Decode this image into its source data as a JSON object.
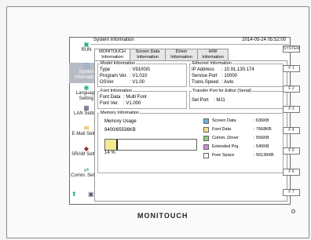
{
  "window": {
    "title": "System Information",
    "datetime": "2014-05-24  05:52:00"
  },
  "sidebar": {
    "items": [
      {
        "label": "RUN",
        "icon": "monitor-icon"
      },
      {
        "label": "System Information",
        "icon": "info-icon"
      },
      {
        "label": "Language Setting",
        "icon": "globe-icon"
      },
      {
        "label": "LAN Setting",
        "icon": "lan-icon"
      },
      {
        "label": "E-Mail Setting",
        "icon": "mail-icon"
      },
      {
        "label": "SRAM Setting",
        "icon": "sram-icon"
      },
      {
        "label": "Comm. Setting",
        "icon": "comm-icon"
      }
    ]
  },
  "tabs": [
    {
      "l1": "MONITOUCH",
      "l2": "Information"
    },
    {
      "l1": "Screen Data",
      "l2": "Information"
    },
    {
      "l1": "Driver",
      "l2": "Information"
    },
    {
      "l1": "H/W",
      "l2": "Information"
    }
  ],
  "model": {
    "title": "Model Information",
    "type_label": "Type",
    "type_value": ":  V9100iS",
    "program_label": "Program Ver.",
    "program_value": ":  V1.010",
    "os_label": "OSVer",
    "os_value": ":  V1.00"
  },
  "ethernet": {
    "title": "Ethernet Information",
    "ip_label": "IP Address",
    "ip_value": ":  10.91.130.174",
    "port_label": "Service Port",
    "port_value": ":  10000",
    "speed_label": "Trans.Speed",
    "speed_value": ":  Auto"
  },
  "font": {
    "title": "Font Information",
    "data_label": "Font Data",
    "data_value": ":  Multi Font",
    "ver_label": "Font Ver.",
    "ver_value": ":  V1.000"
  },
  "transfer": {
    "title": "Transfer Port for Editor (Serial)",
    "port_label": "Set Port",
    "port_value": ":  MJ1"
  },
  "memory": {
    "title": "Memory Information",
    "usage_label": "Memory Usage",
    "usage_value": "9400/65536KB",
    "percent_label": "14 %",
    "percent": 14,
    "legend": [
      {
        "name": "Screen Data",
        "value": ":    636KB",
        "color": "#6fb2d9"
      },
      {
        "name": "Font Data",
        "value": ":   7668KB",
        "color": "#f0e38a"
      },
      {
        "name": "Comm. Driver",
        "value": ":    556KB",
        "color": "#8fce7a"
      },
      {
        "name": "Extended Prg.",
        "value": ":    540KB",
        "color": "#c78fd2"
      },
      {
        "name": "Free Space",
        "value": ":  56136KB",
        "color": "#ffffff"
      }
    ]
  },
  "fkeys": [
    "SYSTEM",
    "F 1",
    "F 2",
    "F 3",
    "F 4",
    "F 5",
    "F 6",
    "F 7"
  ],
  "brand": "MONITOUCH"
}
